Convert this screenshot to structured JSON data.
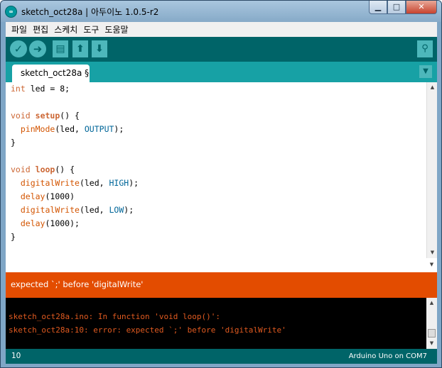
{
  "window": {
    "app_icon_glyph": "∞",
    "title": "sketch_oct28a | 아두이노 1.0.5-r2",
    "minimize_glyph": "▁",
    "maximize_glyph": "□",
    "close_glyph": "✕"
  },
  "menu": {
    "items": [
      "파일",
      "편집",
      "스케치",
      "도구",
      "도움말"
    ]
  },
  "toolbar": {
    "verify_glyph": "✓",
    "upload_glyph": "➜",
    "new_glyph": "▤",
    "open_glyph": "⬆",
    "save_glyph": "⬇",
    "serial_monitor_glyph": "⚲"
  },
  "tabs": {
    "active_label": "sketch_oct28a §",
    "menu_glyph": "▼"
  },
  "editor": {
    "scroll_up_glyph": "▲",
    "scroll_down_glyph": "▼",
    "lines": [
      [
        {
          "t": "int",
          "c": "kw"
        },
        {
          "t": " led = 8;",
          "c": ""
        }
      ],
      [],
      [
        {
          "t": "void",
          "c": "kw"
        },
        {
          "t": " ",
          "c": ""
        },
        {
          "t": "setup",
          "c": "fn"
        },
        {
          "t": "() {",
          "c": ""
        }
      ],
      [
        {
          "t": "  ",
          "c": ""
        },
        {
          "t": "pinMode",
          "c": "bi"
        },
        {
          "t": "(led, ",
          "c": ""
        },
        {
          "t": "OUTPUT",
          "c": "cn"
        },
        {
          "t": ");",
          "c": ""
        }
      ],
      [
        {
          "t": "}",
          "c": ""
        }
      ],
      [],
      [
        {
          "t": "void",
          "c": "kw"
        },
        {
          "t": " ",
          "c": ""
        },
        {
          "t": "loop",
          "c": "fn"
        },
        {
          "t": "() {",
          "c": ""
        }
      ],
      [
        {
          "t": "  ",
          "c": ""
        },
        {
          "t": "digitalWrite",
          "c": "bi"
        },
        {
          "t": "(led, ",
          "c": ""
        },
        {
          "t": "HIGH",
          "c": "cn"
        },
        {
          "t": ");",
          "c": ""
        }
      ],
      [
        {
          "t": "  ",
          "c": ""
        },
        {
          "t": "delay",
          "c": "bi"
        },
        {
          "t": "(1000)",
          "c": ""
        }
      ],
      [
        {
          "t": "  ",
          "c": ""
        },
        {
          "t": "digitalWrite",
          "c": "bi"
        },
        {
          "t": "(led, ",
          "c": ""
        },
        {
          "t": "LOW",
          "c": "cn"
        },
        {
          "t": ");",
          "c": ""
        }
      ],
      [
        {
          "t": "  ",
          "c": ""
        },
        {
          "t": "delay",
          "c": "bi"
        },
        {
          "t": "(1000);",
          "c": ""
        }
      ],
      [
        {
          "t": "}",
          "c": ""
        }
      ]
    ]
  },
  "error": {
    "message": "expected `;' before 'digitalWrite'"
  },
  "console": {
    "lines": [
      "sketch_oct28a.ino: In function 'void loop()':",
      "sketch_oct28a:10: error: expected `;' before 'digitalWrite'"
    ]
  },
  "status": {
    "line_number": "10",
    "board": "Arduino Uno on COM7"
  },
  "colors": {
    "teal_dark": "#006468",
    "teal_tab": "#17a1a5",
    "error_orange": "#e34c00",
    "console_text": "#e05a20"
  }
}
